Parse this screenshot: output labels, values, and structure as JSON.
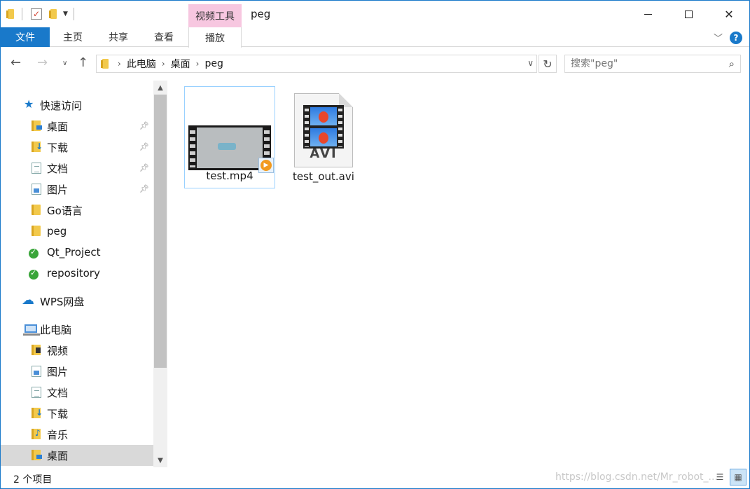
{
  "window": {
    "title": "peg",
    "contextual_tab_group": "视频工具"
  },
  "ribbon": {
    "file": "文件",
    "home": "主页",
    "share": "共享",
    "view": "查看",
    "play": "播放"
  },
  "address": {
    "crumbs": [
      "此电脑",
      "桌面",
      "peg"
    ]
  },
  "search": {
    "placeholder": "搜索\"peg\""
  },
  "sidebar": {
    "items": [
      {
        "label": "快速访问",
        "icon": "star-icon"
      },
      {
        "label": "桌面",
        "icon": "desktop-folder-icon",
        "pinned": true
      },
      {
        "label": "下载",
        "icon": "download-folder-icon",
        "pinned": true
      },
      {
        "label": "文档",
        "icon": "documents-icon",
        "pinned": true
      },
      {
        "label": "图片",
        "icon": "pictures-icon",
        "pinned": true
      },
      {
        "label": "Go语言",
        "icon": "folder-icon"
      },
      {
        "label": "peg",
        "icon": "folder-icon"
      },
      {
        "label": "Qt_Project",
        "icon": "synced-folder-icon"
      },
      {
        "label": "repository",
        "icon": "synced-folder-icon"
      },
      {
        "label": "WPS网盘",
        "icon": "cloud-icon"
      },
      {
        "label": "此电脑",
        "icon": "computer-icon"
      },
      {
        "label": "视频",
        "icon": "videos-icon"
      },
      {
        "label": "图片",
        "icon": "pictures-icon"
      },
      {
        "label": "文档",
        "icon": "documents-icon"
      },
      {
        "label": "下载",
        "icon": "download-folder-icon"
      },
      {
        "label": "音乐",
        "icon": "music-icon"
      },
      {
        "label": "桌面",
        "icon": "desktop-folder-icon",
        "selected": true
      }
    ]
  },
  "files": [
    {
      "name": "test.mp4",
      "icon": "mp4-thumbnail-icon",
      "selected": true
    },
    {
      "name": "test_out.avi",
      "icon": "avi-file-icon",
      "selected": false
    }
  ],
  "status": {
    "count": "2 个项目",
    "watermark": "https://blog.csdn.net/Mr_robot_..."
  },
  "colors": {
    "accent": "#1979ca",
    "contextual_tab": "#f7c7e0",
    "selection_border": "#99d1ff"
  }
}
